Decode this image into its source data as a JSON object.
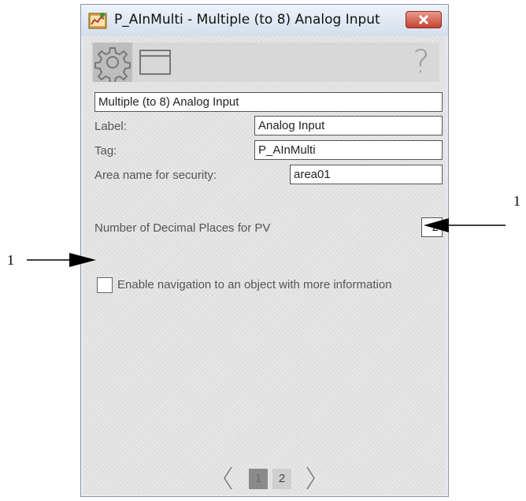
{
  "window": {
    "title": "P_AInMulti - Multiple (to 8) Analog Input"
  },
  "toolbar": {
    "tabs": [
      {
        "icon": "gear-icon",
        "selected": true
      },
      {
        "icon": "display-icon",
        "selected": false
      }
    ],
    "help_label": "?"
  },
  "form": {
    "description_value": "Multiple (to 8) Analog Input",
    "label_caption": "Label:",
    "label_value": "Analog Input",
    "tag_caption": "Tag:",
    "tag_value": "P_AInMulti",
    "area_caption": "Area name for security:",
    "area_value": "area01",
    "decimal_caption": "Number of Decimal Places for PV",
    "decimal_value": "2",
    "nav_checkbox_label": "Enable navigation to an object with more information",
    "nav_checkbox_checked": false
  },
  "pager": {
    "pages": [
      "1",
      "2"
    ],
    "current_page": "1"
  },
  "callouts": {
    "right": "1",
    "left": "1"
  },
  "colors": {
    "close_button": "#c3432f",
    "active_page": "#8a8a8a"
  }
}
